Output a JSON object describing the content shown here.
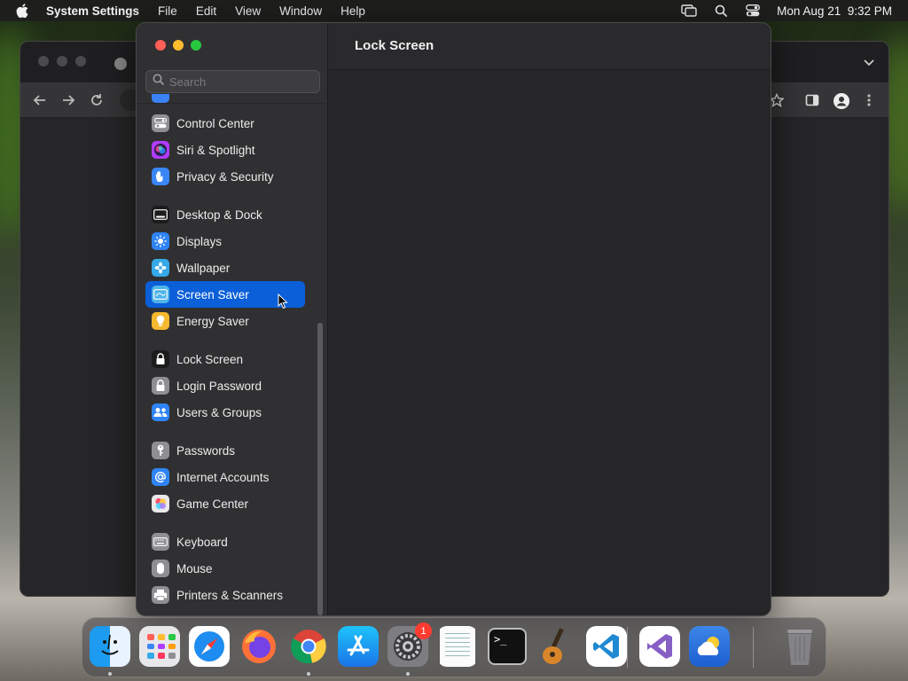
{
  "menubar": {
    "app_name": "System Settings",
    "menus": [
      "File",
      "Edit",
      "View",
      "Window",
      "Help"
    ],
    "datetime": "Mon Aug 21  9:32 PM"
  },
  "settings": {
    "title": "Lock Screen",
    "search": {
      "placeholder": "Search",
      "value": ""
    },
    "sidebar": {
      "selected": "Screen Saver",
      "items": [
        {
          "label": "Control Center",
          "icon": "control-center-icon",
          "color": "#8e8e93"
        },
        {
          "label": "Siri & Spotlight",
          "icon": "siri-icon",
          "color": "#b03cff"
        },
        {
          "label": "Privacy & Security",
          "icon": "hand-icon",
          "color": "#3a86f7"
        },
        {
          "label": "Desktop & Dock",
          "icon": "dock-icon",
          "color": "#1c1c1e"
        },
        {
          "label": "Displays",
          "icon": "sun-icon",
          "color": "#2f84f5"
        },
        {
          "label": "Wallpaper",
          "icon": "flower-icon",
          "color": "#36a9e8"
        },
        {
          "label": "Screen Saver",
          "icon": "screen-saver-icon",
          "color": "#4fb5e8"
        },
        {
          "label": "Energy Saver",
          "icon": "lightbulb-icon",
          "color": "#f5b82e"
        },
        {
          "label": "Lock Screen",
          "icon": "lock-icon",
          "color": "#1c1c1e"
        },
        {
          "label": "Login Password",
          "icon": "lock-badge-icon",
          "color": "#8e8e93"
        },
        {
          "label": "Users & Groups",
          "icon": "users-icon",
          "color": "#2f84f5"
        },
        {
          "label": "Passwords",
          "icon": "key-icon",
          "color": "#8e8e93"
        },
        {
          "label": "Internet Accounts",
          "icon": "at-icon",
          "color": "#2f84f5"
        },
        {
          "label": "Game Center",
          "icon": "game-center-icon",
          "color": "#e9e9ea"
        },
        {
          "label": "Keyboard",
          "icon": "keyboard-icon",
          "color": "#8e8e93"
        },
        {
          "label": "Mouse",
          "icon": "mouse-icon",
          "color": "#8e8e93"
        },
        {
          "label": "Printers & Scanners",
          "icon": "printer-icon",
          "color": "#8e8e93"
        }
      ]
    }
  },
  "dock": {
    "apps": [
      {
        "name": "Finder",
        "icon": "finder-icon",
        "running": true
      },
      {
        "name": "Launchpad",
        "icon": "launchpad-icon",
        "running": false
      },
      {
        "name": "Safari",
        "icon": "safari-icon",
        "running": false
      },
      {
        "name": "Firefox",
        "icon": "firefox-icon",
        "running": false
      },
      {
        "name": "Chrome",
        "icon": "chrome-icon",
        "running": true
      },
      {
        "name": "App Store",
        "icon": "app-store-icon",
        "running": false
      },
      {
        "name": "System Settings",
        "icon": "system-settings-icon",
        "running": true,
        "badge": "1"
      },
      {
        "name": "TextEdit",
        "icon": "textedit-icon",
        "running": false
      },
      {
        "name": "Terminal",
        "icon": "terminal-icon",
        "running": false
      },
      {
        "name": "GarageBand",
        "icon": "garageband-icon",
        "running": false
      },
      {
        "name": "Visual Studio Code",
        "icon": "vscode-icon",
        "running": false
      },
      {
        "name": "Visual Studio",
        "icon": "visual-studio-icon",
        "running": false
      },
      {
        "name": "Weather",
        "icon": "weather-icon",
        "running": false
      },
      {
        "name": "Trash",
        "icon": "trash-icon",
        "running": false
      }
    ]
  }
}
